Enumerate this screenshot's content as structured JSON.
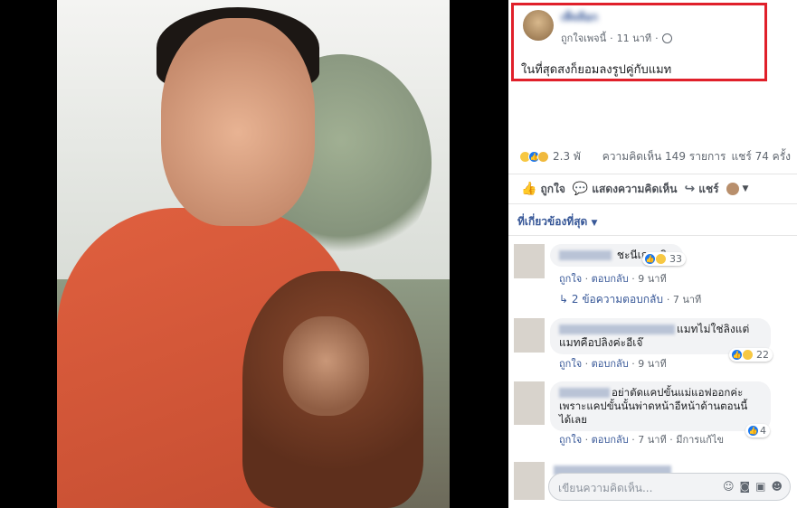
{
  "post": {
    "page_name": "เพ็จลือก",
    "source_label": "ถูกใจเพจนี้",
    "time": "11 นาที",
    "caption": "ในที่สุดสงก็ยอมลงรูปคู่กับแมท"
  },
  "stats": {
    "reactions_count": "2.3 พั",
    "comments": "ความคิดเห็น 149 รายการ",
    "shares": "แชร์ 74 ครั้ง"
  },
  "actions": {
    "like": "ถูกใจ",
    "comment": "แสดงความคิดเห็น",
    "share": "แชร์"
  },
  "sort_label": "ที่เกี่ยวข้องที่สุด",
  "comments": [
    {
      "text": "ชะนีเกาะติด",
      "reaction_count": "33",
      "like_label": "ถูกใจ",
      "reply_label": "ตอบกลับ",
      "time": "9 นาที",
      "replies": "2 ข้อความตอบกลับ",
      "replies_time": "7 นาที"
    },
    {
      "text1": "แมทไม่ใช่ลิงแต่",
      "text2": "แมทคือปลิงค่ะอีเจ๊",
      "reaction_count": "22",
      "like_label": "ถูกใจ",
      "reply_label": "ตอบกลับ",
      "time": "9 นาที"
    },
    {
      "text1": "อย่าตัดแคปขั้นแม่แอฟออกค่ะ",
      "text2": "เพราะแคปขั้นนั้นพ่าดหน้าอีหน้าด้านตอนนี้",
      "text3": "ได้เลย",
      "reaction_count": "4",
      "like_label": "ถูกใจ",
      "reply_label": "ตอบกลับ",
      "time": "7 นาที",
      "edited": "มีการแก้ไข"
    }
  ],
  "composer": {
    "placeholder": "เขียนความคิดเห็น..."
  },
  "colors": {
    "link": "#385898",
    "highlight": "#e0202a",
    "like_blue": "#1877f2"
  }
}
